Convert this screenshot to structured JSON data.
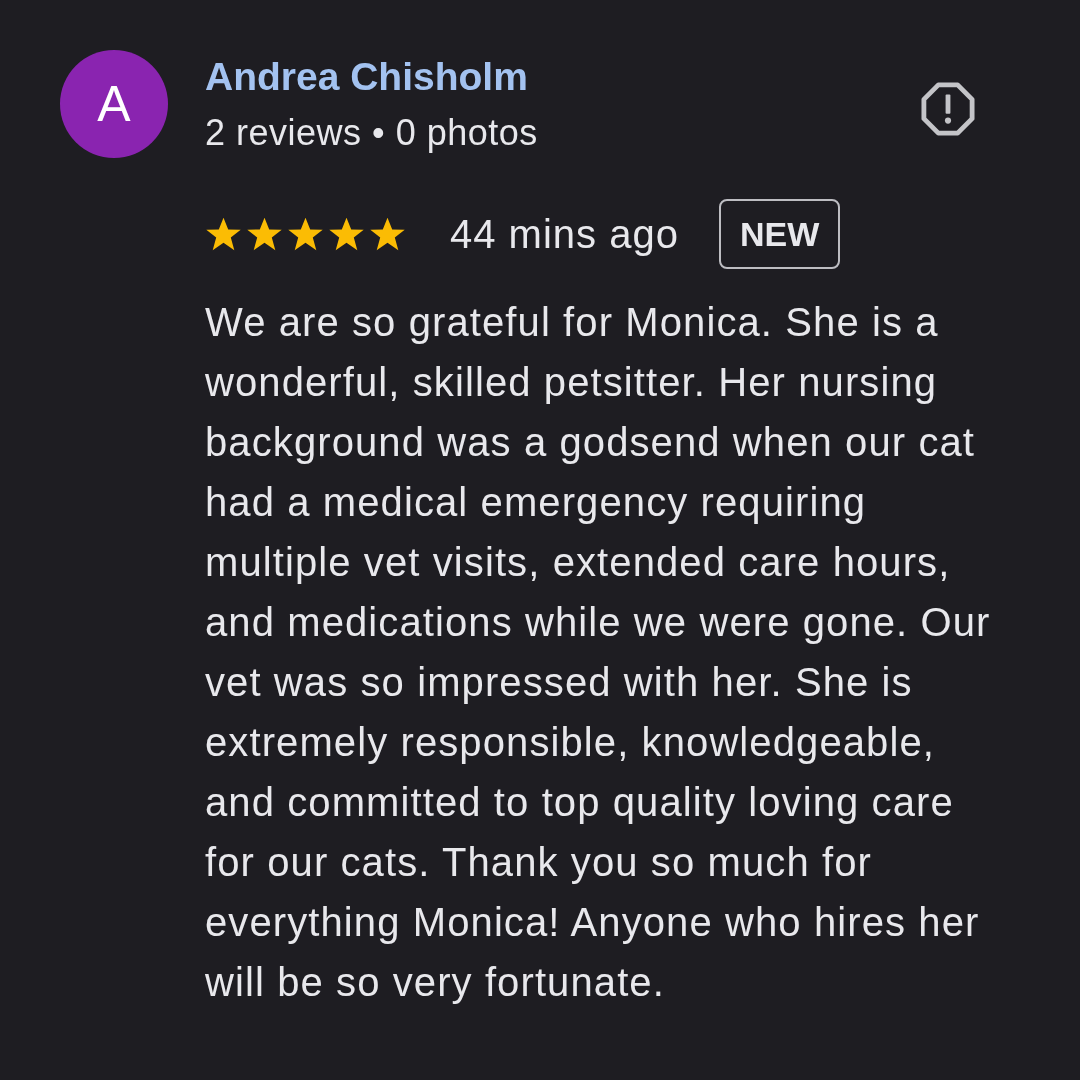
{
  "review": {
    "avatar": {
      "initial": "A"
    },
    "author": {
      "name": "Andrea Chisholm",
      "meta": "2 reviews • 0 photos"
    },
    "rating": {
      "stars": 5
    },
    "time": "44 mins ago",
    "badge": "NEW",
    "text": "We are so grateful for Monica. She is a wonderful, skilled petsitter. Her nursing background was a godsend when our cat had a medical emergency requiring multiple vet visits, extended care hours, and medications while we were gone. Our vet was so impressed with her. She is extremely responsible, knowledgeable, and committed to top quality loving care for our cats. Thank you so much for everything Monica! Anyone who hires her will be so very fortunate."
  }
}
